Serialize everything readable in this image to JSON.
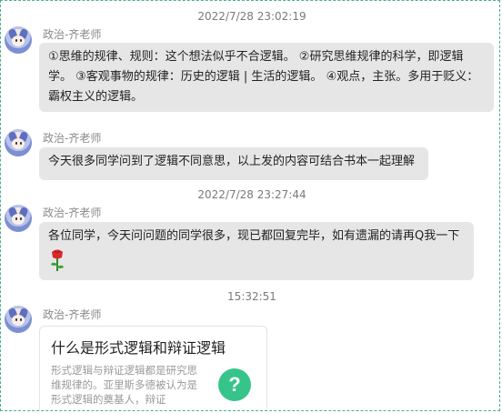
{
  "timestamps": [
    "2022/7/28 23:02:19",
    "2022/7/28 23:27:44",
    "15:32:51"
  ],
  "sender": "政治-齐老师",
  "messages": [
    {
      "lines": [
        "①思维的规律、规则：这个想法似乎不合逻辑。 ②研究思维规律的科学，即逻辑",
        "学。 ③客观事物的规律：历史的逻辑 | 生活的逻辑。 ④观点，主张。多用于贬义：",
        "霸权主义的逻辑。"
      ]
    },
    {
      "lines": [
        "今天很多同学问到了逻辑不同意思，以上发的内容可结合书本一起理解"
      ]
    },
    {
      "lines": [
        "各位同学，今天问问题的同学很多，现已都回复完毕，如有遗漏的请再Q我一下"
      ],
      "emoji": "rose-icon"
    }
  ],
  "card": {
    "title": "什么是形式逻辑和辩证逻辑",
    "desc": [
      "形式逻辑与辩证逻辑都是研究思",
      "维规律的。亚里斯多德被认为是",
      "形式逻辑的奠基人，辩证"
    ],
    "icon": "question-icon",
    "icon_glyph": "?",
    "icon_color": "#36c48a"
  }
}
